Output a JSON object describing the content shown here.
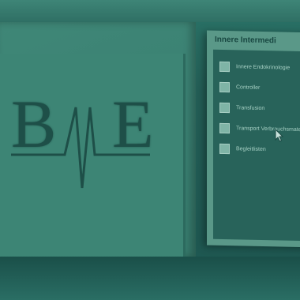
{
  "logo": {
    "left_letter": "B",
    "right_letter": "E"
  },
  "dialog": {
    "title": "Innere Intermedi",
    "items": [
      {
        "label": "Innere Endokrinologie"
      },
      {
        "label": "Controller"
      },
      {
        "label": "Transfusion"
      },
      {
        "label": "Transport Verbrauchsmaterial"
      },
      {
        "label": "Begleitlisten"
      }
    ]
  },
  "icons": {
    "cursor": "mouse-pointer-icon",
    "logo_mark": "heartbeat-v-icon"
  },
  "colors": {
    "tint": "#2a7468",
    "logo_ink": "#1e4f48",
    "panel": "#5a9888"
  }
}
